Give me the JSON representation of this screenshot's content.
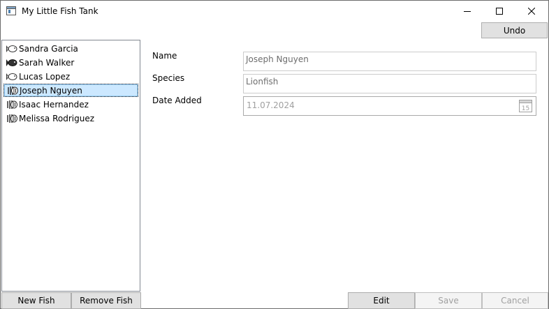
{
  "window": {
    "title": "My Little Fish Tank"
  },
  "toolbar": {
    "undo_label": "Undo"
  },
  "fish_list": {
    "items": [
      {
        "label": "Sandra Garcia",
        "icon": "fish-icon",
        "selected": false
      },
      {
        "label": "Sarah Walker",
        "icon": "fish-dark-icon",
        "selected": false
      },
      {
        "label": "Lucas Lopez",
        "icon": "fish-icon",
        "selected": false
      },
      {
        "label": "Joseph Nguyen",
        "icon": "lionfish-icon",
        "selected": true
      },
      {
        "label": "Isaac Hernandez",
        "icon": "lionfish-icon",
        "selected": false
      },
      {
        "label": "Melissa Rodriguez",
        "icon": "lionfish-icon",
        "selected": false
      }
    ]
  },
  "list_buttons": {
    "new_label": "New Fish",
    "remove_label": "Remove Fish"
  },
  "details": {
    "name_label": "Name",
    "name_value": "Joseph Nguyen",
    "species_label": "Species",
    "species_value": "Lionfish",
    "date_label": "Date Added",
    "date_value": "11.07.2024",
    "calendar_day": "15"
  },
  "actions": {
    "edit_label": "Edit",
    "save_label": "Save",
    "cancel_label": "Cancel"
  },
  "colors": {
    "selection_bg": "#cce8ff",
    "button_bg": "#e1e1e1",
    "disabled_text": "#a0a0a0"
  }
}
